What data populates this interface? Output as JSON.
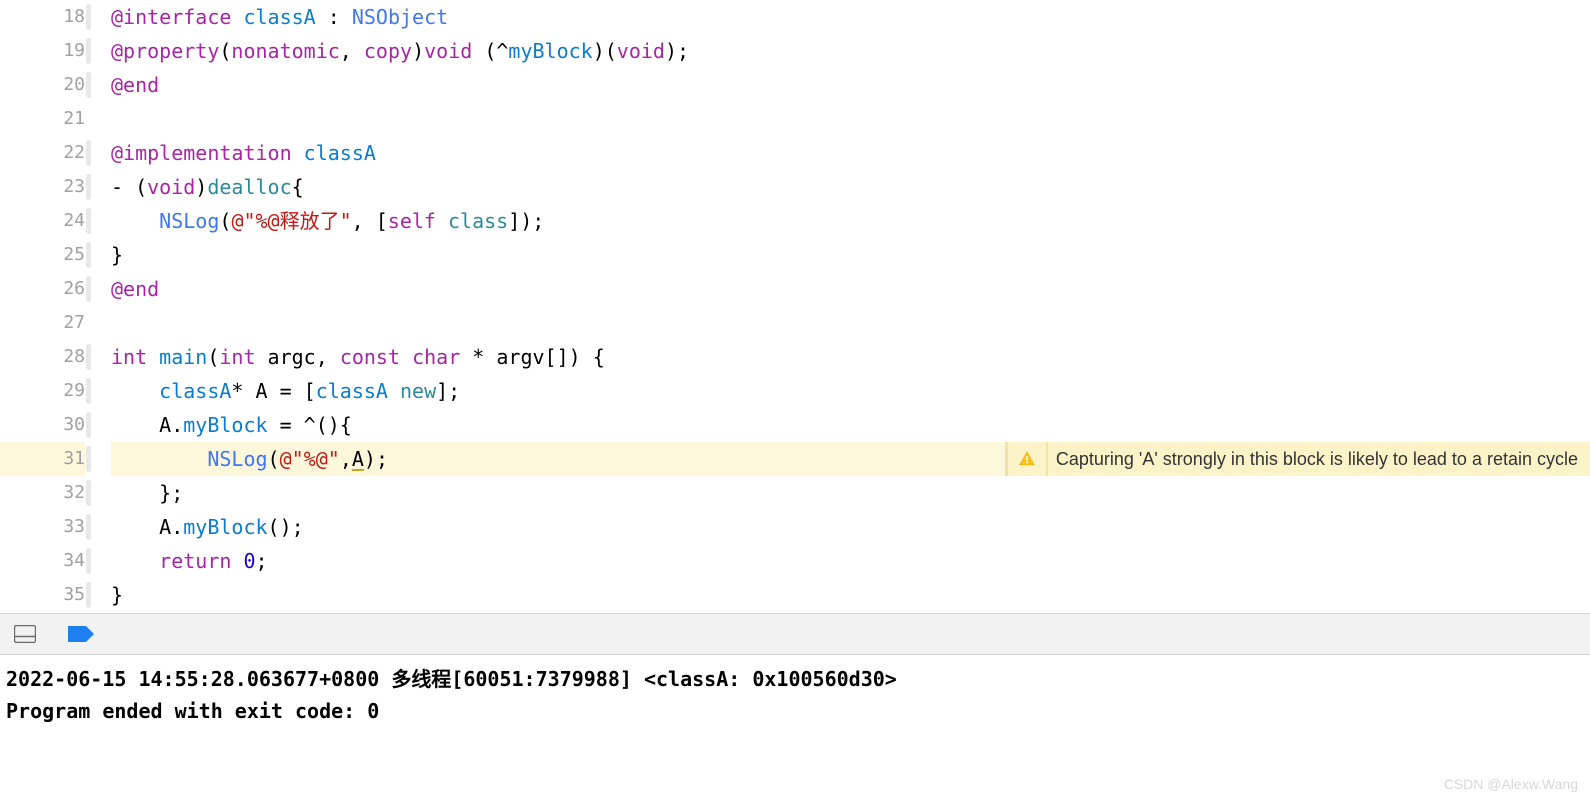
{
  "lines": [
    {
      "num": "18",
      "bar": true,
      "tokens": [
        {
          "t": "@interface",
          "c": "kw"
        },
        {
          "t": " ",
          "c": "plain"
        },
        {
          "t": "classA",
          "c": "id"
        },
        {
          "t": " : ",
          "c": "plain"
        },
        {
          "t": "NSObject",
          "c": "type"
        }
      ]
    },
    {
      "num": "19",
      "bar": true,
      "tokens": [
        {
          "t": "@property",
          "c": "kw"
        },
        {
          "t": "(",
          "c": "plain"
        },
        {
          "t": "nonatomic",
          "c": "kw"
        },
        {
          "t": ", ",
          "c": "plain"
        },
        {
          "t": "copy",
          "c": "kw"
        },
        {
          "t": ")",
          "c": "plain"
        },
        {
          "t": "void",
          "c": "typekw"
        },
        {
          "t": " (^",
          "c": "plain"
        },
        {
          "t": "myBlock",
          "c": "id"
        },
        {
          "t": ")(",
          "c": "plain"
        },
        {
          "t": "void",
          "c": "typekw"
        },
        {
          "t": ");",
          "c": "plain"
        }
      ]
    },
    {
      "num": "20",
      "bar": true,
      "tokens": [
        {
          "t": "@end",
          "c": "kw"
        }
      ]
    },
    {
      "num": "21",
      "bar": false,
      "tokens": []
    },
    {
      "num": "22",
      "bar": true,
      "tokens": [
        {
          "t": "@implementation",
          "c": "kw"
        },
        {
          "t": " ",
          "c": "plain"
        },
        {
          "t": "classA",
          "c": "id"
        }
      ]
    },
    {
      "num": "23",
      "bar": true,
      "tokens": [
        {
          "t": "- (",
          "c": "plain"
        },
        {
          "t": "void",
          "c": "typekw"
        },
        {
          "t": ")",
          "c": "plain"
        },
        {
          "t": "dealloc",
          "c": "method"
        },
        {
          "t": "{",
          "c": "plain"
        }
      ]
    },
    {
      "num": "24",
      "bar": true,
      "tokens": [
        {
          "t": "    ",
          "c": "plain"
        },
        {
          "t": "NSLog",
          "c": "type"
        },
        {
          "t": "(",
          "c": "plain"
        },
        {
          "t": "@\"%@释放了\"",
          "c": "str"
        },
        {
          "t": ", [",
          "c": "plain"
        },
        {
          "t": "self",
          "c": "kw"
        },
        {
          "t": " ",
          "c": "plain"
        },
        {
          "t": "class",
          "c": "method"
        },
        {
          "t": "]);",
          "c": "plain"
        }
      ]
    },
    {
      "num": "25",
      "bar": true,
      "tokens": [
        {
          "t": "}",
          "c": "plain"
        }
      ]
    },
    {
      "num": "26",
      "bar": true,
      "tokens": [
        {
          "t": "@end",
          "c": "kw"
        }
      ]
    },
    {
      "num": "27",
      "bar": false,
      "tokens": []
    },
    {
      "num": "28",
      "bar": true,
      "tokens": [
        {
          "t": "int",
          "c": "typekw"
        },
        {
          "t": " ",
          "c": "plain"
        },
        {
          "t": "main",
          "c": "id"
        },
        {
          "t": "(",
          "c": "plain"
        },
        {
          "t": "int",
          "c": "typekw"
        },
        {
          "t": " argc, ",
          "c": "plain"
        },
        {
          "t": "const",
          "c": "typekw"
        },
        {
          "t": " ",
          "c": "plain"
        },
        {
          "t": "char",
          "c": "typekw"
        },
        {
          "t": " * argv[]) {",
          "c": "plain"
        }
      ]
    },
    {
      "num": "29",
      "bar": true,
      "tokens": [
        {
          "t": "    ",
          "c": "plain"
        },
        {
          "t": "classA",
          "c": "id"
        },
        {
          "t": "* A = [",
          "c": "plain"
        },
        {
          "t": "classA",
          "c": "id"
        },
        {
          "t": " ",
          "c": "plain"
        },
        {
          "t": "new",
          "c": "method"
        },
        {
          "t": "];",
          "c": "plain"
        }
      ]
    },
    {
      "num": "30",
      "bar": true,
      "tokens": [
        {
          "t": "    A.",
          "c": "plain"
        },
        {
          "t": "myBlock",
          "c": "id"
        },
        {
          "t": " = ^(){",
          "c": "plain"
        }
      ]
    },
    {
      "num": "31",
      "bar": true,
      "warning": true,
      "tokens": [
        {
          "t": "        ",
          "c": "plain"
        },
        {
          "t": "NSLog",
          "c": "type"
        },
        {
          "t": "(",
          "c": "plain"
        },
        {
          "t": "@\"%@\"",
          "c": "str"
        },
        {
          "t": ",",
          "c": "plain"
        },
        {
          "t": "A",
          "c": "plain underline-A"
        },
        {
          "t": ");",
          "c": "plain"
        }
      ]
    },
    {
      "num": "32",
      "bar": true,
      "tokens": [
        {
          "t": "    };",
          "c": "plain"
        }
      ]
    },
    {
      "num": "33",
      "bar": true,
      "tokens": [
        {
          "t": "    A.",
          "c": "plain"
        },
        {
          "t": "myBlock",
          "c": "id"
        },
        {
          "t": "();",
          "c": "plain"
        }
      ]
    },
    {
      "num": "34",
      "bar": true,
      "tokens": [
        {
          "t": "    ",
          "c": "plain"
        },
        {
          "t": "return",
          "c": "kw"
        },
        {
          "t": " ",
          "c": "plain"
        },
        {
          "t": "0",
          "c": "num"
        },
        {
          "t": ";",
          "c": "plain"
        }
      ]
    },
    {
      "num": "35",
      "bar": true,
      "tokens": [
        {
          "t": "}",
          "c": "plain"
        }
      ]
    }
  ],
  "warning_text": "Capturing 'A' strongly in this block is likely to lead to a retain cycle",
  "console": [
    "2022-06-15 14:55:28.063677+0800 多线程[60051:7379988] <classA: 0x100560d30>",
    "Program ended with exit code: 0"
  ],
  "watermark": "CSDN @Alexw.Wang"
}
